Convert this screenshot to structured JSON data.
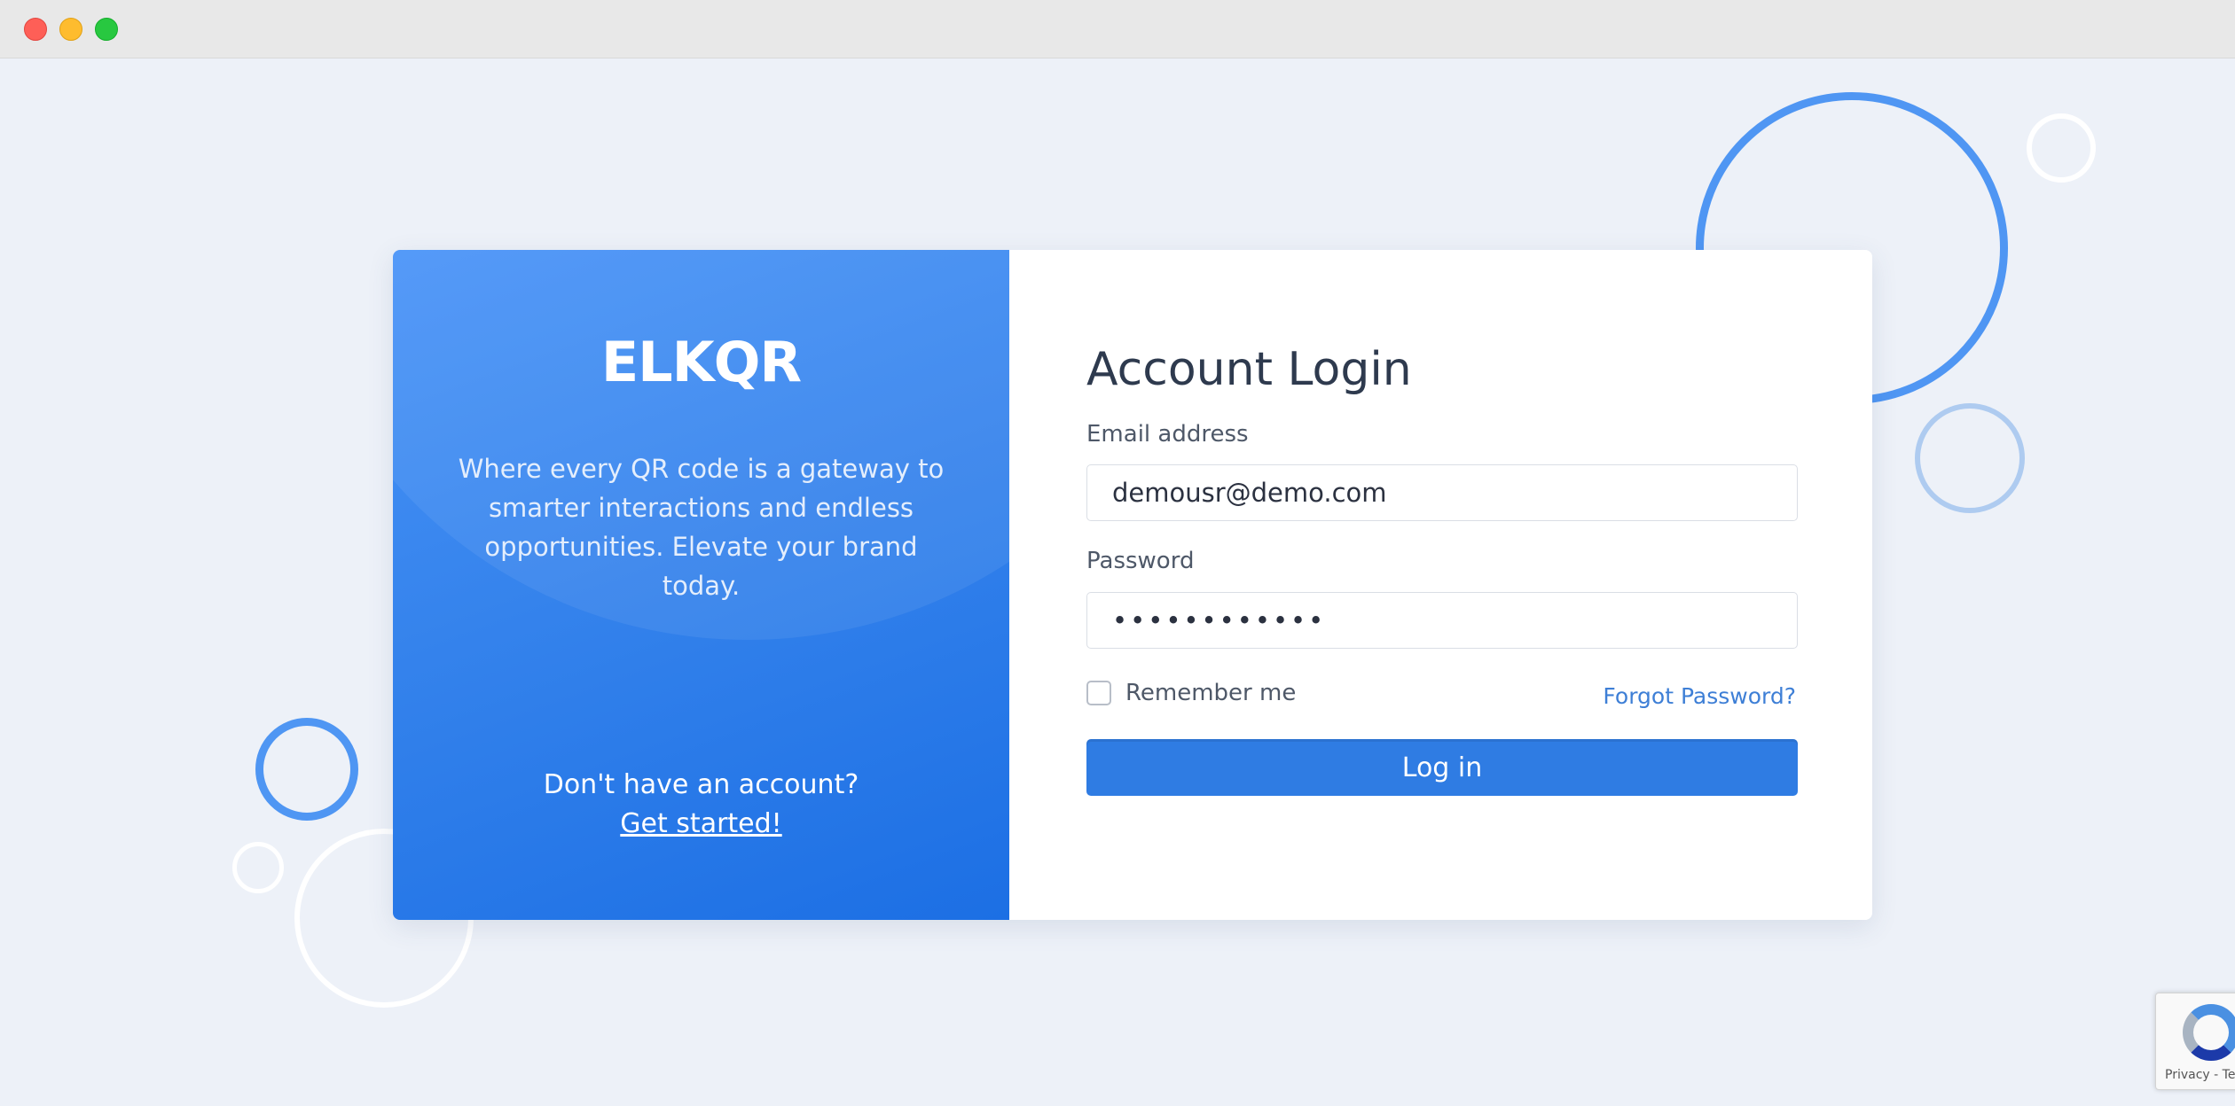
{
  "brand": {
    "name": "ELKQR",
    "tagline": "Where every QR code is a gateway to smarter interactions and endless opportunities. Elevate your brand today."
  },
  "signup": {
    "prompt": "Don't have an account?",
    "link_label": "Get started!"
  },
  "login": {
    "title": "Account Login",
    "email_label": "Email address",
    "email_value": "demousr@demo.com",
    "password_label": "Password",
    "password_value": "••••••••••••",
    "remember_label": "Remember me",
    "forgot_label": "Forgot Password?",
    "submit_label": "Log in"
  },
  "recaptcha": {
    "footer": "Privacy - Te"
  },
  "colors": {
    "primary": "#2f7ce3",
    "panel_gradient_start": "#4893f8",
    "panel_gradient_end": "#1c6fe4",
    "background": "#edf1f8",
    "title_text": "#2e3a4e",
    "link": "#3e7fd6"
  },
  "icons": {
    "window_close": "close-dot",
    "window_minimize": "minimize-dot",
    "window_maximize": "maximize-dot",
    "recaptcha": "recaptcha-logo"
  }
}
